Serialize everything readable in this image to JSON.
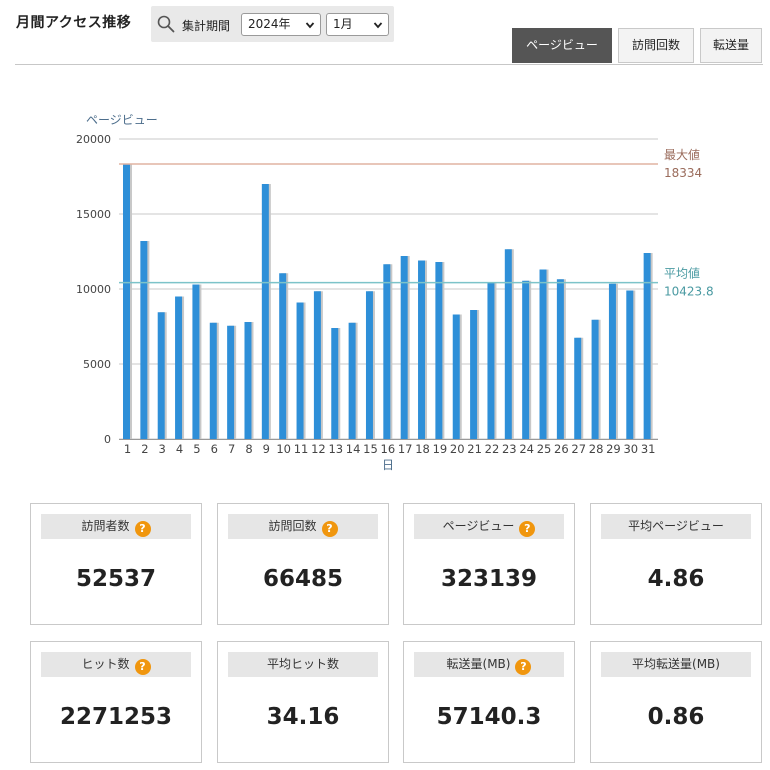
{
  "header": {
    "title": "月間アクセス推移",
    "filter_label": "集計期間",
    "year": "2024年",
    "month": "1月"
  },
  "tabs": [
    {
      "label": "ページビュー",
      "active": true
    },
    {
      "label": "訪問回数",
      "active": false
    },
    {
      "label": "転送量",
      "active": false
    }
  ],
  "chart_data": {
    "type": "bar",
    "ylabel": "ページビュー",
    "xlabel": "日",
    "ylim": [
      0,
      20000
    ],
    "yticks": [
      0,
      5000,
      10000,
      15000,
      20000
    ],
    "categories": [
      "1",
      "2",
      "3",
      "4",
      "5",
      "6",
      "7",
      "8",
      "9",
      "10",
      "11",
      "12",
      "13",
      "14",
      "15",
      "16",
      "17",
      "18",
      "19",
      "20",
      "21",
      "22",
      "23",
      "24",
      "25",
      "26",
      "27",
      "28",
      "29",
      "30",
      "31"
    ],
    "values": [
      18334,
      13200,
      8450,
      9500,
      10300,
      7750,
      7550,
      7800,
      17000,
      11050,
      9100,
      9850,
      7400,
      7750,
      9850,
      11650,
      12200,
      11900,
      11800,
      8300,
      8600,
      10400,
      12650,
      10550,
      11300,
      10650,
      6750,
      7950,
      10350,
      9900,
      12400
    ],
    "reference_lines": [
      {
        "label": "最大値",
        "value": 18334,
        "value_label": "18334",
        "color": "#e0b4a2",
        "label_color": "#9a6b5b"
      },
      {
        "label": "平均値",
        "value": 10423.8,
        "value_label": "10423.8",
        "color": "#7cc3c9",
        "label_color": "#4a9aa2"
      }
    ],
    "grid": true,
    "colors": {
      "bar": "#2e8fd8",
      "bar_shadow": "#c8c8c8",
      "grid": "#c8c8c8"
    }
  },
  "cards": [
    {
      "label": "訪問者数",
      "value": "52537",
      "help": true
    },
    {
      "label": "訪問回数",
      "value": "66485",
      "help": true
    },
    {
      "label": "ページビュー",
      "value": "323139",
      "help": true
    },
    {
      "label": "平均ページビュー",
      "value": "4.86",
      "help": false
    },
    {
      "label": "ヒット数",
      "value": "2271253",
      "help": true
    },
    {
      "label": "平均ヒット数",
      "value": "34.16",
      "help": false
    },
    {
      "label": "転送量(MB)",
      "value": "57140.3",
      "help": true
    },
    {
      "label": "平均転送量(MB)",
      "value": "0.86",
      "help": false
    }
  ],
  "help_glyph": "?",
  "icons": {
    "search": "magnifier-icon",
    "help": "question-circle-icon",
    "dropdown": "chevron-down-icon"
  }
}
